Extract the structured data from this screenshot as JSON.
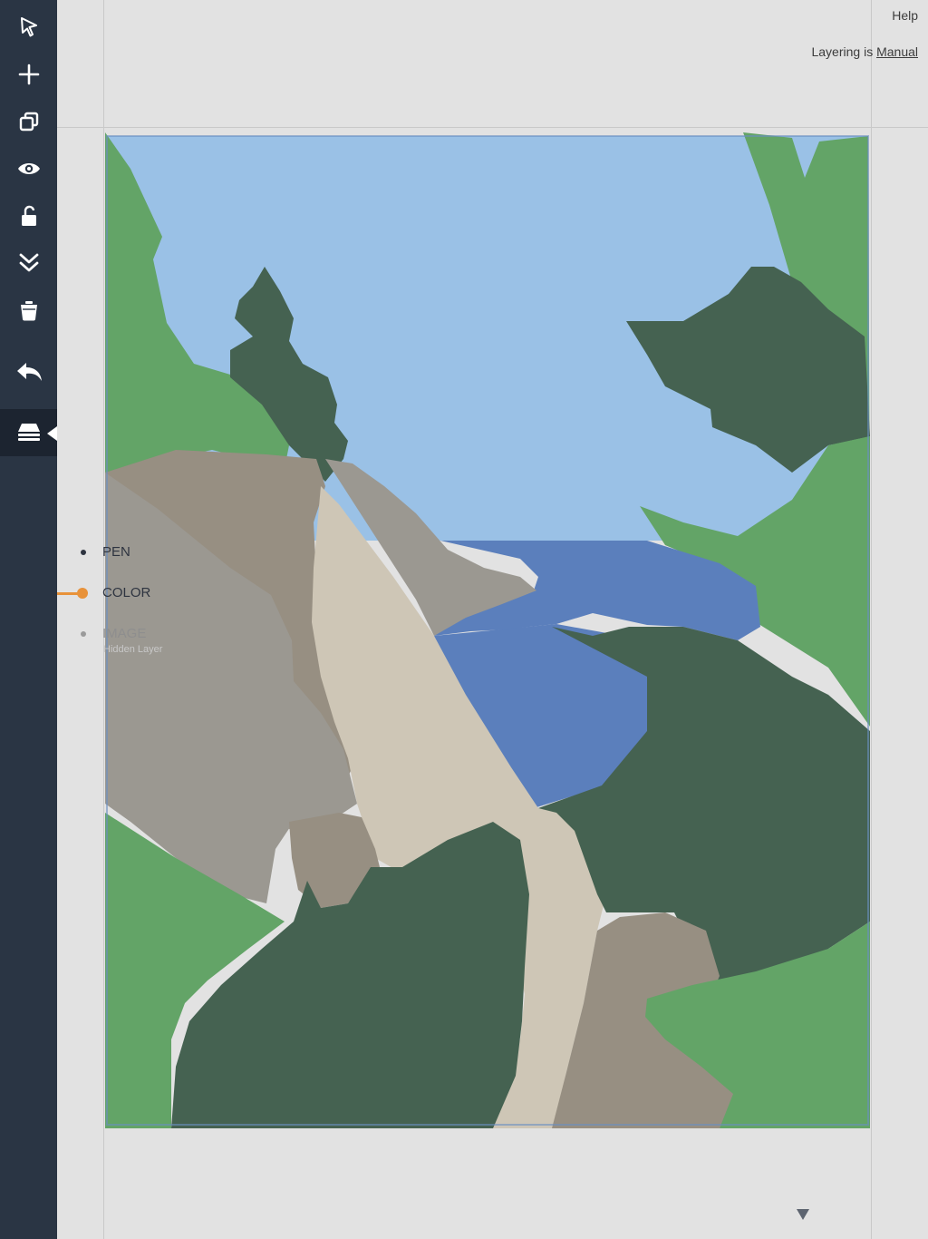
{
  "toolbar": {
    "tools": [
      {
        "name": "pointer",
        "icon": "cursor-arrow-icon"
      },
      {
        "name": "add",
        "icon": "plus-icon"
      },
      {
        "name": "duplicate",
        "icon": "duplicate-icon"
      },
      {
        "name": "visibility",
        "icon": "eye-icon"
      },
      {
        "name": "lock",
        "icon": "unlock-icon"
      },
      {
        "name": "send-back",
        "icon": "double-chevron-down-icon"
      },
      {
        "name": "delete",
        "icon": "trash-icon"
      },
      {
        "name": "undo",
        "icon": "undo-arrow-icon"
      },
      {
        "name": "layers",
        "icon": "layers-icon",
        "active": true
      }
    ]
  },
  "header": {
    "help": "Help",
    "layering_prefix": "Layering is",
    "layering_mode": "Manual"
  },
  "layers": {
    "pen": "PEN",
    "color": "COLOR",
    "image": "IMAGE",
    "image_sub": "Hidden Layer",
    "selected": "COLOR"
  },
  "colors": {
    "toolbar_bg": "#2a3544",
    "accent": "#e8923a",
    "sky": "#9ac1e6",
    "water": "#5b7fbc",
    "light_green": "#63a467",
    "dark_green": "#456251",
    "stone": "#9b9891",
    "taupe": "#978f82",
    "sand": "#cec6b6"
  }
}
